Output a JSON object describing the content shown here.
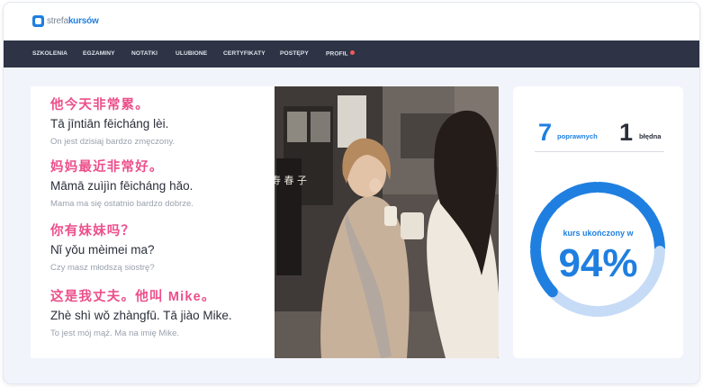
{
  "brand": {
    "name_light": "strefa",
    "name_bold": "kursów"
  },
  "nav": {
    "items": [
      "SZKOLENIA",
      "EGZAMINY",
      "NOTATKI",
      "ULUBIONE",
      "CERTYFIKATY",
      "POSTĘPY",
      "PROFIL"
    ],
    "profile_has_notification": true
  },
  "phrases": [
    {
      "hanzi": "他今天非常累。",
      "pinyin": "Tā jīntiān fēicháng lèi.",
      "translation": "On jest dzisiaj bardzo zmęczony."
    },
    {
      "hanzi": "妈妈最近非常好。",
      "pinyin": "Māmā zuìjìn fēicháng hǎo.",
      "translation": "Mama ma się ostatnio bardzo dobrze."
    },
    {
      "hanzi": "你有妹妹吗？",
      "pinyin": "Nǐ yǒu mèimei ma?",
      "translation": "Czy masz młodszą siostrę?"
    },
    {
      "hanzi": "这是我丈夫。他叫 Mike。",
      "pinyin": "Zhè shì wǒ zhàngfū. Tā jiào Mike.",
      "translation": "To jest mój mąż. Ma na imię Mike."
    }
  ],
  "photo": {
    "sign_text": "寿 春 子"
  },
  "stats": {
    "correct_count": "7",
    "correct_label": "poprawnych",
    "wrong_count": "1",
    "wrong_label": "błędna"
  },
  "progress": {
    "caption": "kurs ukończony w",
    "value_text": "94%",
    "percent": 94
  },
  "colors": {
    "accent": "#1f7fe0",
    "pink": "#ec4f8a",
    "nav_bg": "#2e3445",
    "gauge_light": "#c6dbf6"
  }
}
